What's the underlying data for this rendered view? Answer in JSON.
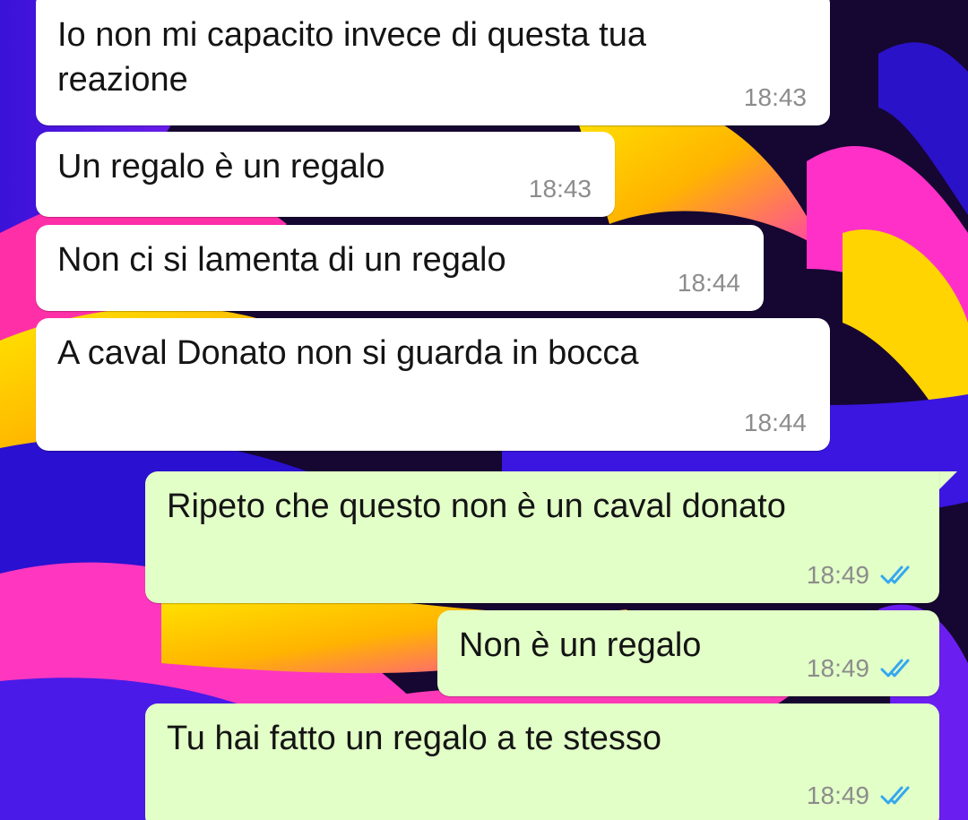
{
  "messages": [
    {
      "direction": "incoming",
      "text": "Io non mi capacito invece di questa tua\nreazione",
      "time": "18:43"
    },
    {
      "direction": "incoming",
      "text": "Un regalo è un regalo",
      "time": "18:43"
    },
    {
      "direction": "incoming",
      "text": "Non ci si lamenta di un regalo",
      "time": "18:44"
    },
    {
      "direction": "incoming",
      "text": "A caval Donato non si guarda in bocca",
      "time": "18:44"
    },
    {
      "direction": "outgoing",
      "text": "Ripeto che questo non è un caval donato",
      "time": "18:49",
      "status": "read",
      "status_icon": "double-check-icon"
    },
    {
      "direction": "outgoing",
      "text": "Non è un regalo",
      "time": "18:49",
      "status": "read",
      "status_icon": "double-check-icon"
    },
    {
      "direction": "outgoing",
      "text": "Tu hai fatto un regalo a te stesso",
      "time": "18:49",
      "status": "read",
      "status_icon": "double-check-icon"
    }
  ],
  "colors": {
    "incoming_bubble": "#ffffff",
    "outgoing_bubble": "#e2ffc7",
    "read_tick": "#34a8f0",
    "timestamp": "#8c8c8c"
  }
}
